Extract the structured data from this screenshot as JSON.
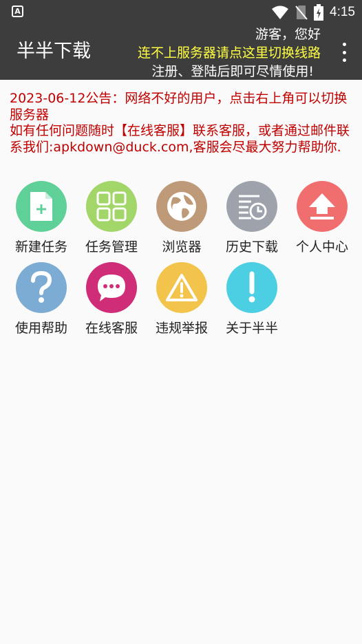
{
  "status_bar": {
    "left_icon": "A",
    "time": "4:15",
    "icons": [
      "wifi-icon",
      "no-sim-icon",
      "battery-charging-icon"
    ]
  },
  "app_bar": {
    "title": "半半下载",
    "greeting": "游客，您好",
    "switch_line": "连不上服务器请点这里切换线路",
    "register_tip": "注册、登陆后即可尽情使用!",
    "menu_icon": "more-vert-icon"
  },
  "notice": {
    "line1": "2023-06-12公告：网络不好的用户，点击右上角可以切换服务器",
    "line2": "如有任何问题随时【在线客服】联系客服，或者通过邮件联系我们:apkdown@duck.com,客服会尽最大努力帮助你."
  },
  "menu": [
    {
      "label": "新建任务",
      "icon": "new-file-icon",
      "color": "#5fd097"
    },
    {
      "label": "任务管理",
      "icon": "grid-icon",
      "color": "#a3d668"
    },
    {
      "label": "浏览器",
      "icon": "globe-icon",
      "color": "#be9a78"
    },
    {
      "label": "历史下载",
      "icon": "history-icon",
      "color": "#9ea3ab"
    },
    {
      "label": "个人中心",
      "icon": "upload-icon",
      "color": "#f16e6e"
    },
    {
      "label": "使用帮助",
      "icon": "question-icon",
      "color": "#7cabd3"
    },
    {
      "label": "在线客服",
      "icon": "chat-icon",
      "color": "#d02d79"
    },
    {
      "label": "违规举报",
      "icon": "warning-icon",
      "color": "#f3c44c"
    },
    {
      "label": "关于半半",
      "icon": "info-exclamation-icon",
      "color": "#4ccee3"
    }
  ]
}
